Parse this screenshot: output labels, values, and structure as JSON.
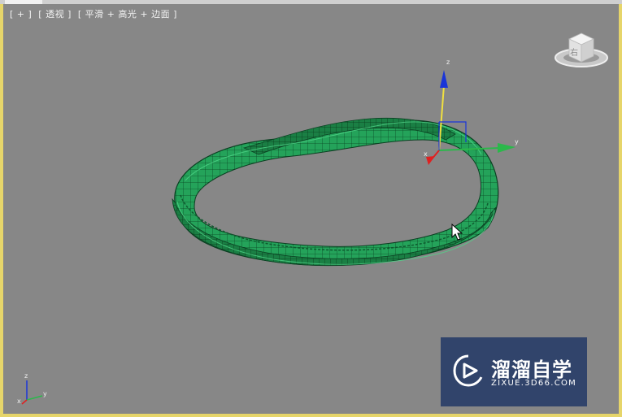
{
  "viewport": {
    "label_parts": [
      "[ + ]",
      "[ 透视 ]",
      "[ 平滑 + 高光 + 边面 ]"
    ],
    "frame_color": "#e6d56a",
    "background_color": "#878787"
  },
  "viewcube": {
    "face_label": "右"
  },
  "gizmo": {
    "x_label": "x",
    "y_label": "y",
    "z_label": "z"
  },
  "axis_tripod": {
    "x_label": "x",
    "y_label": "y",
    "z_label": "z"
  },
  "model": {
    "name": "mobius-band",
    "color": "#1f9a52"
  },
  "watermark": {
    "title": "溜溜自学",
    "subtitle": "ZIXUE.3D66.COM",
    "background_color": "#31446b"
  }
}
